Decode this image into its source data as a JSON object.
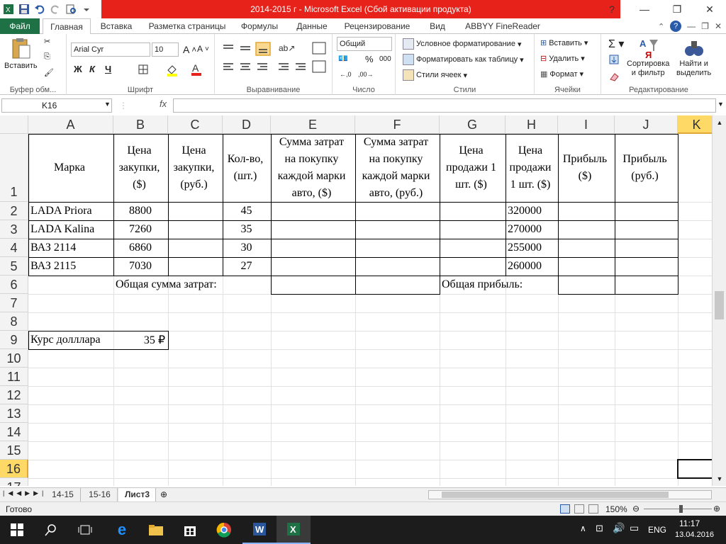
{
  "window": {
    "title": "2014-2015 г  -  Microsoft Excel (Сбой активации продукта)"
  },
  "tabs": [
    "Файл",
    "Главная",
    "Вставка",
    "Разметка страницы",
    "Формулы",
    "Данные",
    "Рецензирование",
    "Вид",
    "ABBYY FineReader 12"
  ],
  "ribbon": {
    "clipboard": {
      "paste": "Вставить",
      "label": "Буфер обм..."
    },
    "font": {
      "name": "Arial Cyr",
      "size": "10",
      "bold": "Ж",
      "italic": "К",
      "underline": "Ч",
      "label": "Шрифт"
    },
    "alignment": {
      "label": "Выравнивание"
    },
    "number": {
      "format": "Общий",
      "percent": "%",
      "thousands": "000",
      "label": "Число"
    },
    "styles": {
      "conditional": "Условное форматирование",
      "as_table": "Форматировать как таблицу",
      "cell_styles": "Стили ячеек",
      "label": "Стили"
    },
    "cells": {
      "insert": "Вставить",
      "delete": "Удалить",
      "format": "Формат",
      "label": "Ячейки"
    },
    "editing": {
      "sort_l1": "Сортировка",
      "sort_l2": "и фильтр",
      "find_l1": "Найти и",
      "find_l2": "выделить",
      "label": "Редактирование"
    }
  },
  "formula_bar": {
    "name_box": "K16",
    "fx": "fx",
    "value": ""
  },
  "columns": [
    "A",
    "B",
    "C",
    "D",
    "E",
    "F",
    "G",
    "H",
    "I",
    "J",
    "K"
  ],
  "rows": [
    "1",
    "2",
    "3",
    "4",
    "5",
    "6",
    "7",
    "8",
    "9",
    "10",
    "11",
    "12",
    "13",
    "14",
    "15",
    "16",
    "17"
  ],
  "headers": {
    "A": [
      "Марка"
    ],
    "B": [
      "Цена",
      "закупки,",
      "($)"
    ],
    "C": [
      "Цена",
      "закупки,",
      "(руб.)"
    ],
    "D": [
      "Кол-во,",
      "(шт.)"
    ],
    "E": [
      "Сумма затрат",
      "на покупку",
      "каждой марки",
      "авто, ($)"
    ],
    "F": [
      "Сумма затрат",
      "на покупку",
      "каждой марки",
      "авто, (руб.)"
    ],
    "G": [
      "Цена",
      "продажи 1",
      "шт. ($)"
    ],
    "H": [
      "Цена",
      "продажи",
      "1 шт. ($)"
    ],
    "I": [
      "Прибыль",
      "($)"
    ],
    "J": [
      "Прибыль",
      "(руб.)"
    ]
  },
  "data_rows": [
    {
      "brand": "LADA Priora",
      "price": "8800",
      "qty": "45",
      "sale": "320000"
    },
    {
      "brand": "LADA Kalina",
      "price": "7260",
      "qty": "35",
      "sale": "270000"
    },
    {
      "brand": "ВАЗ 2114",
      "price": "6860",
      "qty": "30",
      "sale": "255000"
    },
    {
      "brand": "ВАЗ 2115",
      "price": "7030",
      "qty": "27",
      "sale": "260000"
    }
  ],
  "totals": {
    "cost_label": "Общая сумма затрат:",
    "profit_label": "Общая прибыль:"
  },
  "rate": {
    "label": "Курс долллара",
    "value": "35 ₽"
  },
  "sheets": [
    "14-15",
    "15-16",
    "Лист3"
  ],
  "status": {
    "ready": "Готово",
    "zoom": "150%"
  },
  "taskbar": {
    "lang": "ENG",
    "time": "11:17",
    "date": "13.04.2016"
  },
  "colors": {
    "title_red": "#e7221b",
    "excel_green": "#1e7145"
  }
}
